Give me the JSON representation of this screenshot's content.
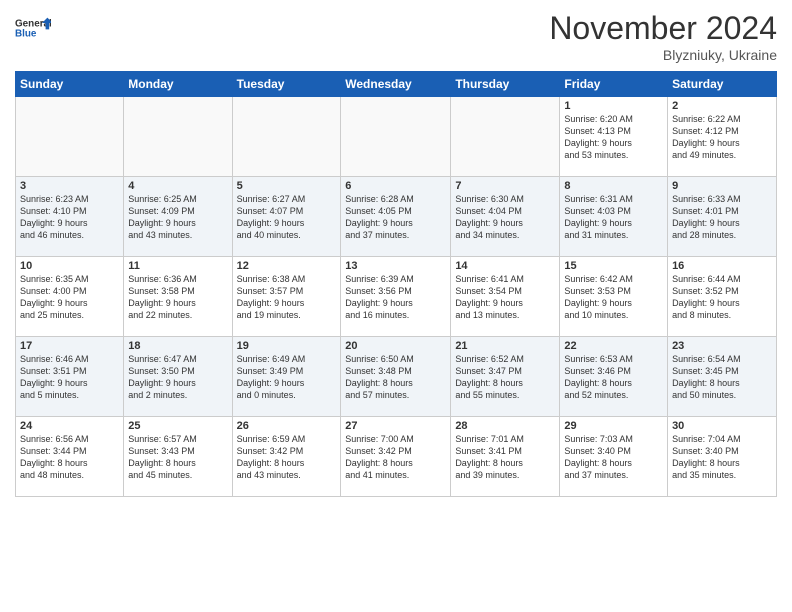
{
  "header": {
    "logo_line1": "General",
    "logo_line2": "Blue",
    "title": "November 2024",
    "location": "Blyzniuky, Ukraine"
  },
  "weekdays": [
    "Sunday",
    "Monday",
    "Tuesday",
    "Wednesday",
    "Thursday",
    "Friday",
    "Saturday"
  ],
  "weeks": [
    [
      {
        "day": "",
        "info": ""
      },
      {
        "day": "",
        "info": ""
      },
      {
        "day": "",
        "info": ""
      },
      {
        "day": "",
        "info": ""
      },
      {
        "day": "",
        "info": ""
      },
      {
        "day": "1",
        "info": "Sunrise: 6:20 AM\nSunset: 4:13 PM\nDaylight: 9 hours\nand 53 minutes."
      },
      {
        "day": "2",
        "info": "Sunrise: 6:22 AM\nSunset: 4:12 PM\nDaylight: 9 hours\nand 49 minutes."
      }
    ],
    [
      {
        "day": "3",
        "info": "Sunrise: 6:23 AM\nSunset: 4:10 PM\nDaylight: 9 hours\nand 46 minutes."
      },
      {
        "day": "4",
        "info": "Sunrise: 6:25 AM\nSunset: 4:09 PM\nDaylight: 9 hours\nand 43 minutes."
      },
      {
        "day": "5",
        "info": "Sunrise: 6:27 AM\nSunset: 4:07 PM\nDaylight: 9 hours\nand 40 minutes."
      },
      {
        "day": "6",
        "info": "Sunrise: 6:28 AM\nSunset: 4:05 PM\nDaylight: 9 hours\nand 37 minutes."
      },
      {
        "day": "7",
        "info": "Sunrise: 6:30 AM\nSunset: 4:04 PM\nDaylight: 9 hours\nand 34 minutes."
      },
      {
        "day": "8",
        "info": "Sunrise: 6:31 AM\nSunset: 4:03 PM\nDaylight: 9 hours\nand 31 minutes."
      },
      {
        "day": "9",
        "info": "Sunrise: 6:33 AM\nSunset: 4:01 PM\nDaylight: 9 hours\nand 28 minutes."
      }
    ],
    [
      {
        "day": "10",
        "info": "Sunrise: 6:35 AM\nSunset: 4:00 PM\nDaylight: 9 hours\nand 25 minutes."
      },
      {
        "day": "11",
        "info": "Sunrise: 6:36 AM\nSunset: 3:58 PM\nDaylight: 9 hours\nand 22 minutes."
      },
      {
        "day": "12",
        "info": "Sunrise: 6:38 AM\nSunset: 3:57 PM\nDaylight: 9 hours\nand 19 minutes."
      },
      {
        "day": "13",
        "info": "Sunrise: 6:39 AM\nSunset: 3:56 PM\nDaylight: 9 hours\nand 16 minutes."
      },
      {
        "day": "14",
        "info": "Sunrise: 6:41 AM\nSunset: 3:54 PM\nDaylight: 9 hours\nand 13 minutes."
      },
      {
        "day": "15",
        "info": "Sunrise: 6:42 AM\nSunset: 3:53 PM\nDaylight: 9 hours\nand 10 minutes."
      },
      {
        "day": "16",
        "info": "Sunrise: 6:44 AM\nSunset: 3:52 PM\nDaylight: 9 hours\nand 8 minutes."
      }
    ],
    [
      {
        "day": "17",
        "info": "Sunrise: 6:46 AM\nSunset: 3:51 PM\nDaylight: 9 hours\nand 5 minutes."
      },
      {
        "day": "18",
        "info": "Sunrise: 6:47 AM\nSunset: 3:50 PM\nDaylight: 9 hours\nand 2 minutes."
      },
      {
        "day": "19",
        "info": "Sunrise: 6:49 AM\nSunset: 3:49 PM\nDaylight: 9 hours\nand 0 minutes."
      },
      {
        "day": "20",
        "info": "Sunrise: 6:50 AM\nSunset: 3:48 PM\nDaylight: 8 hours\nand 57 minutes."
      },
      {
        "day": "21",
        "info": "Sunrise: 6:52 AM\nSunset: 3:47 PM\nDaylight: 8 hours\nand 55 minutes."
      },
      {
        "day": "22",
        "info": "Sunrise: 6:53 AM\nSunset: 3:46 PM\nDaylight: 8 hours\nand 52 minutes."
      },
      {
        "day": "23",
        "info": "Sunrise: 6:54 AM\nSunset: 3:45 PM\nDaylight: 8 hours\nand 50 minutes."
      }
    ],
    [
      {
        "day": "24",
        "info": "Sunrise: 6:56 AM\nSunset: 3:44 PM\nDaylight: 8 hours\nand 48 minutes."
      },
      {
        "day": "25",
        "info": "Sunrise: 6:57 AM\nSunset: 3:43 PM\nDaylight: 8 hours\nand 45 minutes."
      },
      {
        "day": "26",
        "info": "Sunrise: 6:59 AM\nSunset: 3:42 PM\nDaylight: 8 hours\nand 43 minutes."
      },
      {
        "day": "27",
        "info": "Sunrise: 7:00 AM\nSunset: 3:42 PM\nDaylight: 8 hours\nand 41 minutes."
      },
      {
        "day": "28",
        "info": "Sunrise: 7:01 AM\nSunset: 3:41 PM\nDaylight: 8 hours\nand 39 minutes."
      },
      {
        "day": "29",
        "info": "Sunrise: 7:03 AM\nSunset: 3:40 PM\nDaylight: 8 hours\nand 37 minutes."
      },
      {
        "day": "30",
        "info": "Sunrise: 7:04 AM\nSunset: 3:40 PM\nDaylight: 8 hours\nand 35 minutes."
      }
    ]
  ]
}
